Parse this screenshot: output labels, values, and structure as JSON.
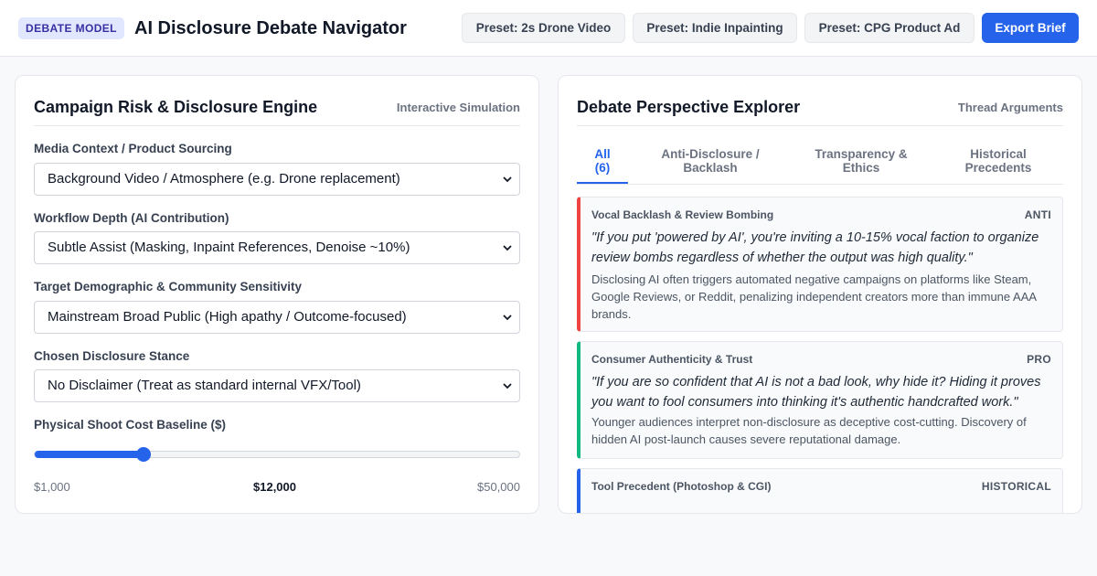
{
  "header": {
    "badge": "DEBATE MODEL",
    "title": "AI Disclosure Debate Navigator",
    "presets": [
      "Preset: 2s Drone Video",
      "Preset: Indie Inpainting",
      "Preset: CPG Product Ad"
    ],
    "export_label": "Export Brief"
  },
  "left_panel": {
    "title": "Campaign Risk & Disclosure Engine",
    "subtitle": "Interactive Simulation",
    "fields": [
      {
        "label": "Media Context / Product Sourcing",
        "value": "Background Video / Atmosphere (e.g. Drone replacement)"
      },
      {
        "label": "Workflow Depth (AI Contribution)",
        "value": "Subtle Assist (Masking, Inpaint References, Denoise ~10%)"
      },
      {
        "label": "Target Demographic & Community Sensitivity",
        "value": "Mainstream Broad Public (High apathy / Outcome-focused)"
      },
      {
        "label": "Chosen Disclosure Stance",
        "value": "No Disclaimer (Treat as standard internal VFX/Tool)"
      }
    ],
    "slider": {
      "label": "Physical Shoot Cost Baseline ($)",
      "min_label": "$1,000",
      "value_label": "$12,000",
      "max_label": "$50,000",
      "min": 1000,
      "max": 50000,
      "value": 12000
    }
  },
  "right_panel": {
    "title": "Debate Perspective Explorer",
    "subtitle": "Thread Arguments",
    "tabs": [
      {
        "label": "All (6)",
        "active": true
      },
      {
        "label": "Anti-Disclosure / Backlash",
        "active": false
      },
      {
        "label": "Transparency & Ethics",
        "active": false
      },
      {
        "label": "Historical Precedents",
        "active": false
      }
    ],
    "cards": [
      {
        "heading": "Vocal Backlash & Review Bombing",
        "tag": "ANTI",
        "color": "#ef4444",
        "quote": "\"If you put 'powered by AI', you're inviting a 10-15% vocal faction to organize review bombs regardless of whether the output was high quality.\"",
        "body": "Disclosing AI often triggers automated negative campaigns on platforms like Steam, Google Reviews, or Reddit, penalizing independent creators more than immune AAA brands."
      },
      {
        "heading": "Consumer Authenticity & Trust",
        "tag": "PRO",
        "color": "#10b981",
        "quote": "\"If you are so confident that AI is not a bad look, why hide it? Hiding it proves you want to fool consumers into thinking it's authentic handcrafted work.\"",
        "body": "Younger audiences interpret non-disclosure as deceptive cost-cutting. Discovery of hidden AI post-launch causes severe reputational damage."
      },
      {
        "heading": "Tool Precedent (Photoshop & CGI)",
        "tag": "HISTORICAL",
        "color": "#2563eb",
        "quote": "",
        "body": ""
      }
    ]
  },
  "colors": {
    "accent": "#2563eb",
    "anti": "#ef4444",
    "pro": "#10b981",
    "historical": "#2563eb"
  }
}
